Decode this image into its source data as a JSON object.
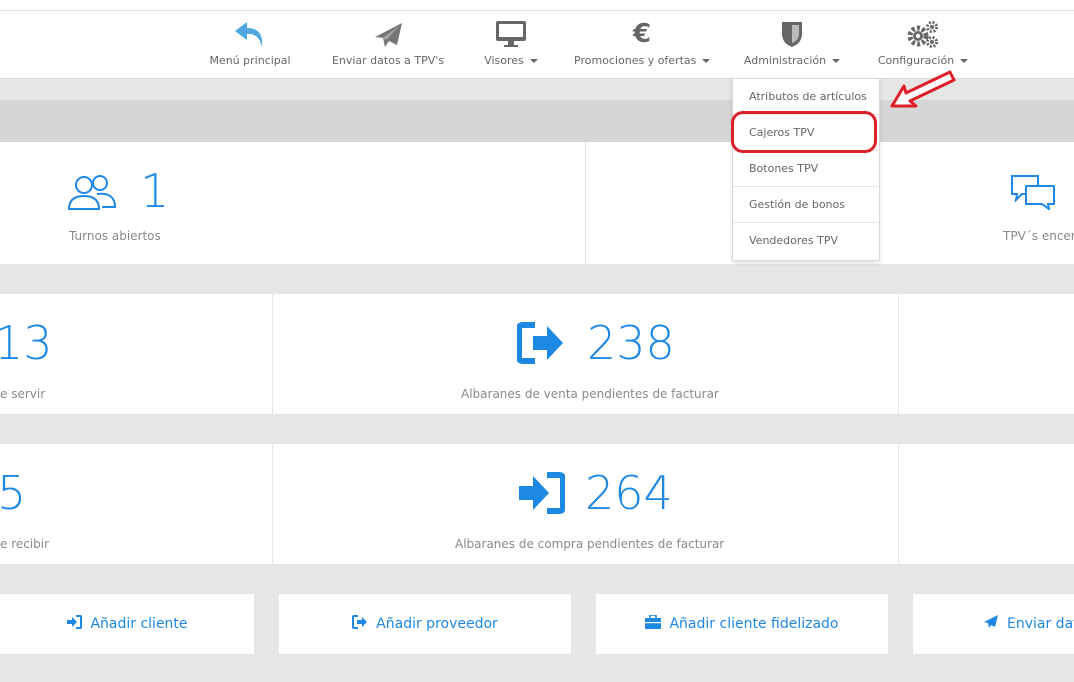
{
  "nav": {
    "items": [
      {
        "label": "Menú principal",
        "icon": "undo-arrow-icon",
        "dropdown": false
      },
      {
        "label": "Enviar datos a TPV's",
        "icon": "paper-plane-icon",
        "dropdown": false
      },
      {
        "label": "Visores",
        "icon": "monitor-icon",
        "dropdown": true
      },
      {
        "label": "Promociones y ofertas",
        "icon": "euro-icon",
        "dropdown": true
      },
      {
        "label": "Administración",
        "icon": "shield-icon",
        "dropdown": true
      },
      {
        "label": "Configuración",
        "icon": "gears-icon",
        "dropdown": true
      }
    ]
  },
  "dropdown": {
    "items": [
      "Atributos de artículos",
      "Cajeros TPV",
      "Botones TPV",
      "Gestión de bonos",
      "Vendedores TPV"
    ],
    "highlighted": "Cajeros TPV"
  },
  "stats": {
    "turnos": {
      "value": "1",
      "label": "Turnos abiertos"
    },
    "tpv_cerrados": {
      "label": "TPV´s encer"
    },
    "pedidos_servir": {
      "value": "13",
      "label": "e servir"
    },
    "albaranes_venta": {
      "value": "238",
      "label": "Albaranes de venta pendientes de facturar"
    },
    "pedidos_recibir": {
      "value": "5",
      "label": "e recibir"
    },
    "albaranes_compra": {
      "value": "264",
      "label": "Albaranes de compra pendientes de facturar"
    }
  },
  "actions": {
    "add_client": "Añadir cliente",
    "add_supplier": "Añadir proveedor",
    "add_loyal_client": "Añadir cliente fidelizado",
    "send_data": "Enviar dat"
  },
  "colors": {
    "accent": "#1e88e5",
    "highlight": "#dd1f2a",
    "icon_gray": "#777777"
  }
}
